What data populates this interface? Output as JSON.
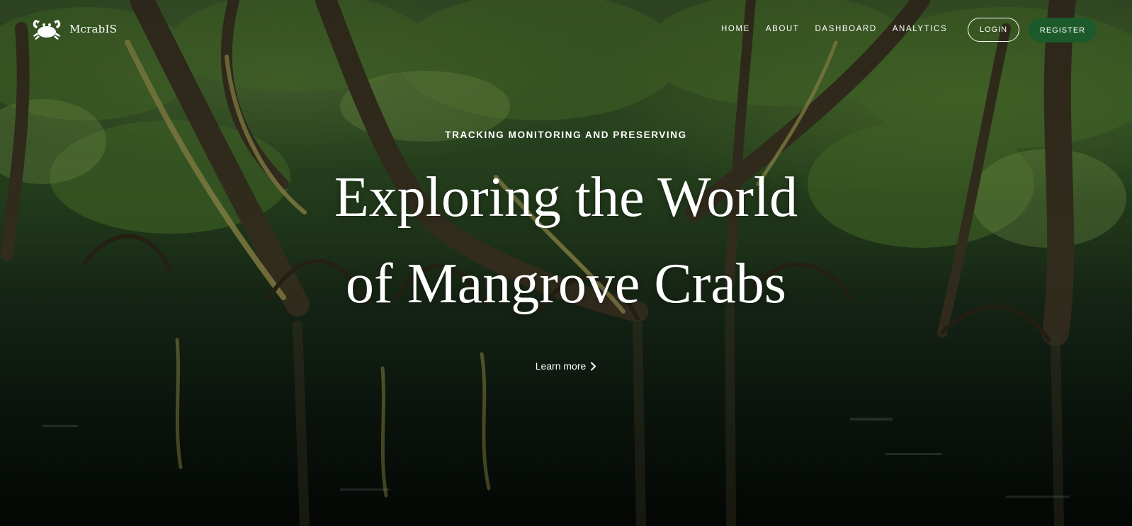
{
  "brand": {
    "name": "McrabIS",
    "icon": "crab-icon"
  },
  "nav": {
    "links": [
      "HOME",
      "ABOUT",
      "DASHBOARD",
      "ANALYTICS"
    ],
    "login_label": "LOGIN",
    "register_label": "REGISTER"
  },
  "hero": {
    "eyebrow": "TRACKING MONITORING AND PRESERVING",
    "headline_line1": "Exploring the World",
    "headline_line2": "of Mangrove Crabs",
    "cta_label": "Learn more",
    "cta_icon": "chevron-right-icon",
    "background": "mangrove-forest-photo"
  },
  "colors": {
    "register_button": "#1d5a2b",
    "text": "#ffffff"
  }
}
